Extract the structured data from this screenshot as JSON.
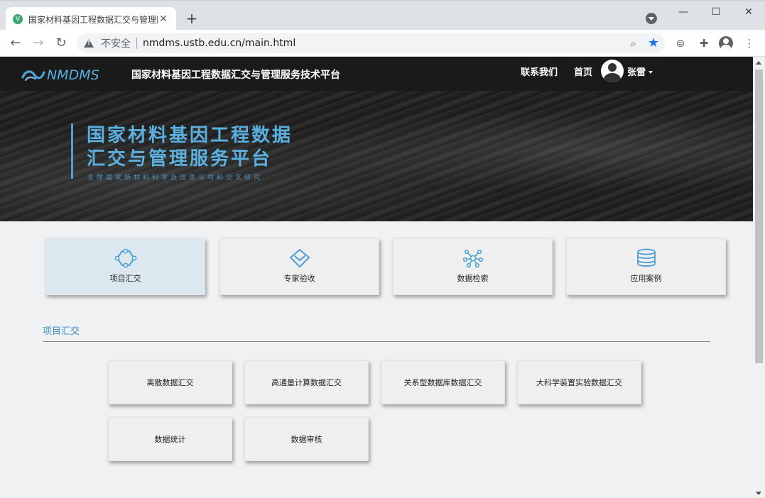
{
  "browser": {
    "tab_title": "国家材料基因工程数据汇交与管理服务技术平台",
    "favicon_letter": "V",
    "tab_close": "✕",
    "new_tab": "+",
    "window_controls": {
      "minimize": "—",
      "maximize": "☐",
      "close": "✕"
    },
    "nav": {
      "back": "←",
      "forward": "→",
      "reload": "↻"
    },
    "security_label": "不安全",
    "url": "nmdms.ustb.edu.cn/main.html",
    "zoom_icon": "⌕",
    "star_icon": "★",
    "extensions": {
      "reader": "⊜",
      "puzzle": "✚",
      "menu": "⋮"
    }
  },
  "header": {
    "logo_text": "NMDMS",
    "site_name": "国家材料基因工程数据汇交与管理服务技术平台",
    "nav_contact": "联系我们",
    "nav_home": "首页",
    "username": "张雷"
  },
  "banner": {
    "title_line1": "国家材料基因工程数据",
    "title_line2": "汇交与管理服务平台",
    "subtitle": "支撑国家新材料科学及信息与材料交叉研究"
  },
  "main_cards": [
    {
      "label": "项目汇交",
      "icon": "project-submit-icon",
      "active": true
    },
    {
      "label": "专家验收",
      "icon": "expert-review-icon",
      "active": false
    },
    {
      "label": "数据检索",
      "icon": "data-search-icon",
      "active": false
    },
    {
      "label": "应用案例",
      "icon": "database-icon",
      "active": false
    }
  ],
  "section": {
    "title": "项目汇交"
  },
  "sub_cards": [
    {
      "label": "离散数据汇交"
    },
    {
      "label": "高通量计算数据汇交"
    },
    {
      "label": "关系型数据库数据汇交"
    },
    {
      "label": "大科学装置实验数据汇交"
    },
    {
      "label": "数据统计"
    },
    {
      "label": "数据审核"
    }
  ],
  "colors": {
    "accent": "#3f8fc8",
    "header_bg": "#1a1a1a",
    "active_card": "#dbe8ef",
    "icon": "#4a9fd4"
  }
}
